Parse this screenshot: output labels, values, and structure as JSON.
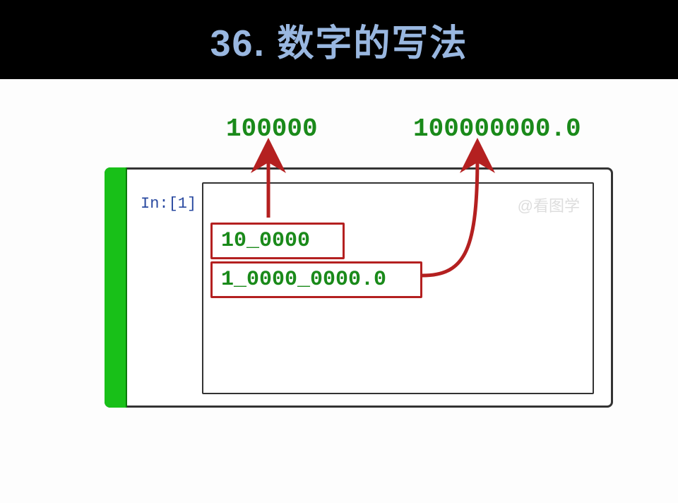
{
  "header": {
    "title": "36. 数字的写法"
  },
  "top": {
    "val1": "100000",
    "val2": "100000000.0"
  },
  "panel": {
    "in_label": "In:[1]",
    "watermark": "@看图学",
    "code1": "10_0000",
    "code2": "1_0000_0000.0"
  }
}
